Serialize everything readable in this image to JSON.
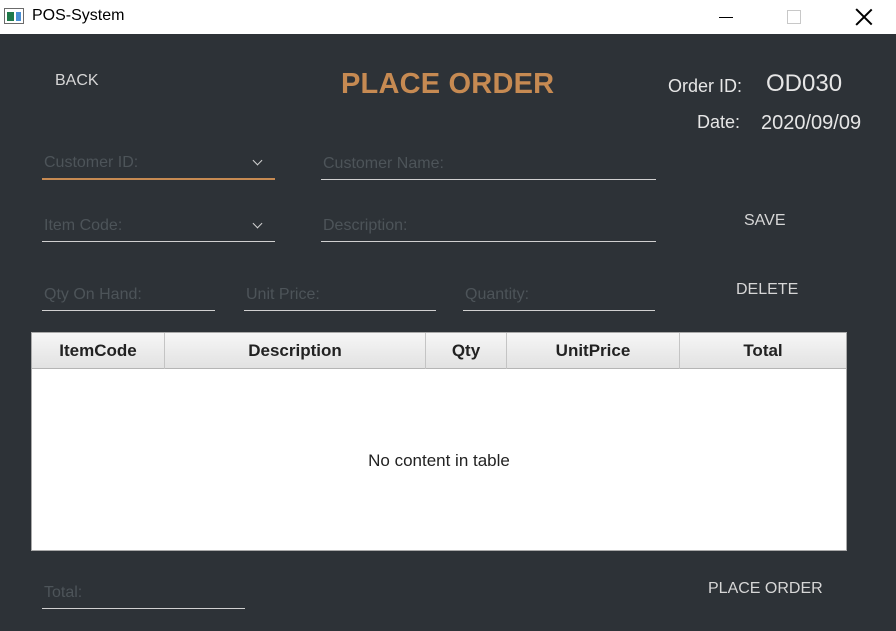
{
  "window": {
    "title": "POS-System",
    "icons": {
      "app": "app-window-icon",
      "minimize": "minimize-icon",
      "maximize": "maximize-icon",
      "close": "close-icon"
    }
  },
  "header": {
    "back_label": "BACK",
    "title": "PLACE ORDER",
    "title_color": "#c68a52",
    "order_id_label": "Order ID:",
    "order_id_value": "OD030",
    "date_label": "Date:",
    "date_value": "2020/09/09"
  },
  "form": {
    "customer_id": {
      "placeholder": "Customer ID:",
      "value": ""
    },
    "customer_name": {
      "placeholder": "Customer Name:",
      "value": ""
    },
    "item_code": {
      "placeholder": "Item Code:",
      "value": ""
    },
    "description": {
      "placeholder": "Description:",
      "value": ""
    },
    "qty_on_hand": {
      "placeholder": "Qty On Hand:",
      "value": ""
    },
    "unit_price": {
      "placeholder": "Unit Price:",
      "value": ""
    },
    "quantity": {
      "placeholder": "Quantity:",
      "value": ""
    },
    "total": {
      "placeholder": "Total:",
      "value": ""
    }
  },
  "actions": {
    "save_label": "SAVE",
    "delete_label": "DELETE",
    "place_order_label": "PLACE ORDER"
  },
  "table": {
    "columns": [
      "ItemCode",
      "Description",
      "Qty",
      "UnitPrice",
      "Total"
    ],
    "rows": [],
    "empty_message": "No content in table"
  },
  "theme": {
    "panel_background": "#2d3237",
    "accent": "#c68a52"
  }
}
